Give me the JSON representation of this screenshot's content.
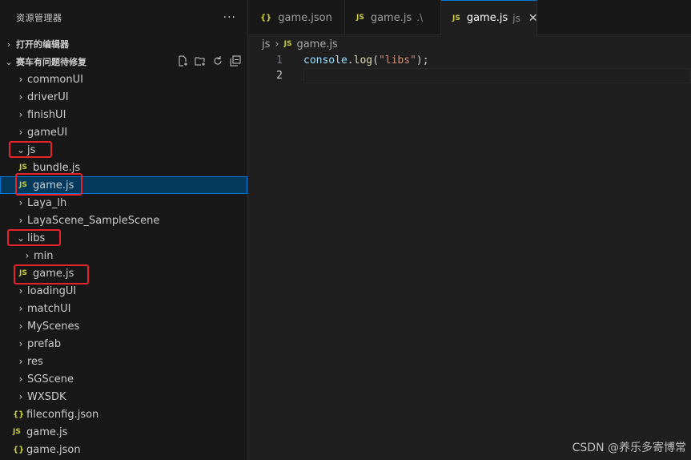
{
  "sidebar": {
    "title": "资源管理器",
    "more": "···",
    "open_editors": "打开的编辑器",
    "project": "赛车有问题待修复",
    "items": [
      {
        "label": "commonUI",
        "type": "folder"
      },
      {
        "label": "driverUI",
        "type": "folder"
      },
      {
        "label": "finishUI",
        "type": "folder"
      },
      {
        "label": "gameUI",
        "type": "folder"
      },
      {
        "label": "js",
        "type": "folder-open"
      },
      {
        "label": "bundle.js",
        "type": "js"
      },
      {
        "label": "game.js",
        "type": "js"
      },
      {
        "label": "Laya_lh",
        "type": "folder"
      },
      {
        "label": "LayaScene_SampleScene",
        "type": "folder"
      },
      {
        "label": "libs",
        "type": "folder-open"
      },
      {
        "label": "min",
        "type": "folder"
      },
      {
        "label": "game.js",
        "type": "js"
      },
      {
        "label": "loadingUI",
        "type": "folder"
      },
      {
        "label": "matchUI",
        "type": "folder"
      },
      {
        "label": "MyScenes",
        "type": "folder"
      },
      {
        "label": "prefab",
        "type": "folder"
      },
      {
        "label": "res",
        "type": "folder"
      },
      {
        "label": "SGScene",
        "type": "folder"
      },
      {
        "label": "WXSDK",
        "type": "folder"
      },
      {
        "label": "fileconfig.json",
        "type": "json"
      },
      {
        "label": "game.js",
        "type": "js"
      },
      {
        "label": "game.json",
        "type": "json"
      }
    ]
  },
  "icons": {
    "js": "JS",
    "json": "{}"
  },
  "tabs": [
    {
      "label": "game.json",
      "desc": ""
    },
    {
      "label": "game.js",
      "desc": ".\\"
    },
    {
      "label": "game.js",
      "desc": "js",
      "close": "✕"
    }
  ],
  "breadcrumb": {
    "folder": "js",
    "file": "game.js"
  },
  "editor": {
    "lines": [
      {
        "number": "1",
        "id": "console",
        "dot": ".",
        "fn": "log",
        "open": "(",
        "str": "\"libs\"",
        "close": ");"
      },
      {
        "number": "2"
      }
    ]
  },
  "watermark": "CSDN @养乐多寄博常",
  "colors": {
    "accent": "#0078d4",
    "highlight": "#e8242b",
    "js_icon": "#cbcb41"
  }
}
